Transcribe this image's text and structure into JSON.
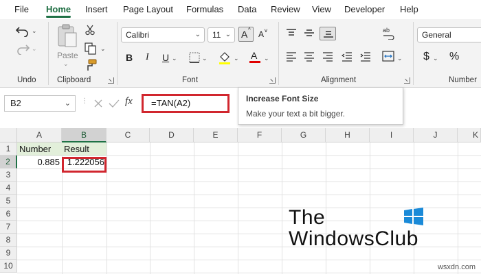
{
  "menu": {
    "tabs": [
      "File",
      "Home",
      "Insert",
      "Page Layout",
      "Formulas",
      "Data",
      "Review",
      "View",
      "Developer",
      "Help"
    ],
    "active_tab": "Home"
  },
  "ribbon": {
    "groups": {
      "undo": "Undo",
      "clipboard": "Clipboard",
      "font": "Font",
      "alignment": "Alignment",
      "number": "Number"
    },
    "paste_label": "Paste",
    "font_name": "Calibri",
    "font_size": "11",
    "number_format": "General",
    "bold_label": "B",
    "italic_label": "I",
    "underline_label": "U",
    "currency_symbol": "$",
    "percent_symbol": "%"
  },
  "tooltip": {
    "title": "Increase Font Size",
    "description": "Make your text a bit bigger."
  },
  "formula_bar": {
    "name_box": "B2",
    "formula": "=TAN(A2)",
    "fx_label": "fx"
  },
  "sheet": {
    "columns": [
      "A",
      "B",
      "C",
      "D",
      "E",
      "F",
      "G",
      "H",
      "I",
      "J",
      "K"
    ],
    "rows": [
      "1",
      "2",
      "3",
      "4",
      "5",
      "6",
      "7",
      "8",
      "9",
      "10"
    ],
    "selected_column": "B",
    "selected_row": "2",
    "cells": {
      "A1": "Number",
      "B1": "Result",
      "A2": "0.885",
      "B2": "1.222056"
    }
  },
  "watermark": {
    "line1": "The",
    "line2": "WindowsClub",
    "site": "wsxdn.com"
  },
  "colors": {
    "accent_green": "#1e7145",
    "highlight_red": "#d1262e",
    "header_fill": "#e2efda"
  }
}
